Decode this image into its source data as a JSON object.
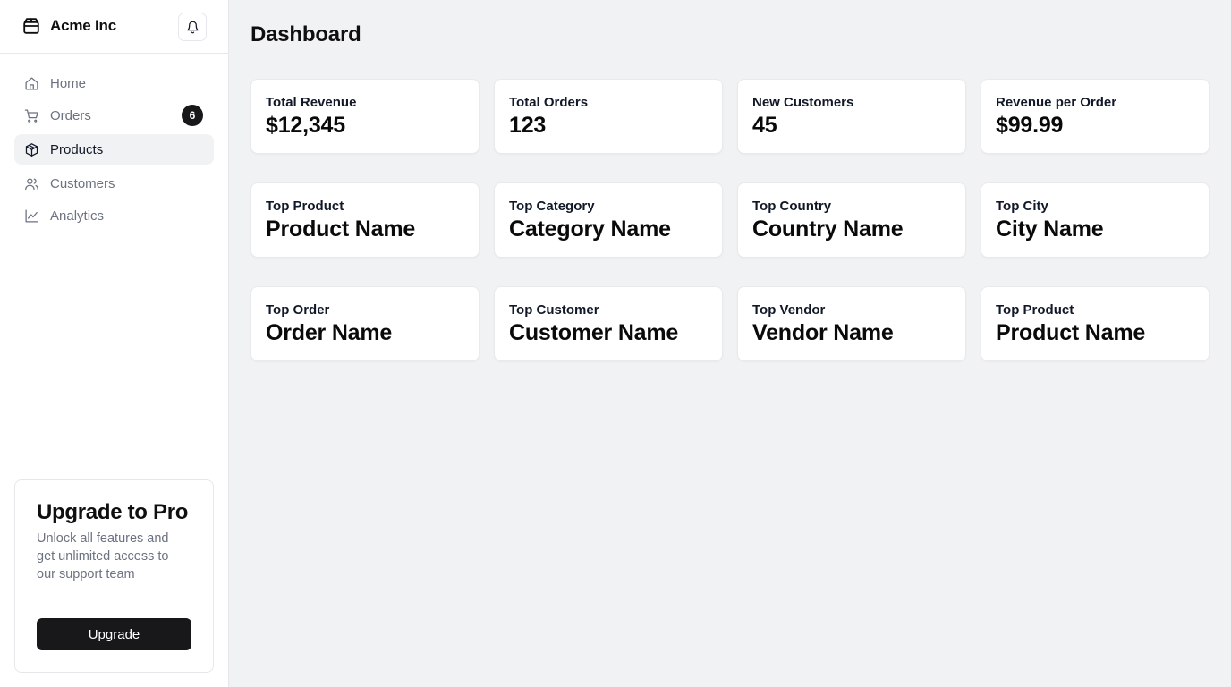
{
  "brand": {
    "name": "Acme Inc",
    "icon": "package-icon"
  },
  "header": {
    "notifications_icon": "bell-icon"
  },
  "sidebar": {
    "items": [
      {
        "label": "Home",
        "icon": "home-icon",
        "active": false
      },
      {
        "label": "Orders",
        "icon": "cart-icon",
        "active": false,
        "badge": "6"
      },
      {
        "label": "Products",
        "icon": "box-icon",
        "active": true
      },
      {
        "label": "Customers",
        "icon": "users-icon",
        "active": false
      },
      {
        "label": "Analytics",
        "icon": "line-chart-icon",
        "active": false
      }
    ]
  },
  "upgrade": {
    "title": "Upgrade to Pro",
    "description": "Unlock all features and get unlimited access to our support team",
    "button_label": "Upgrade"
  },
  "main": {
    "title": "Dashboard",
    "cards": [
      {
        "label": "Total Revenue",
        "value": "$12,345"
      },
      {
        "label": "Total Orders",
        "value": "123"
      },
      {
        "label": "New Customers",
        "value": "45"
      },
      {
        "label": "Revenue per Order",
        "value": "$99.99"
      },
      {
        "label": "Top Product",
        "value": "Product Name"
      },
      {
        "label": "Top Category",
        "value": "Category Name"
      },
      {
        "label": "Top Country",
        "value": "Country Name"
      },
      {
        "label": "Top City",
        "value": "City Name"
      },
      {
        "label": "Top Order",
        "value": "Order Name"
      },
      {
        "label": "Top Customer",
        "value": "Customer Name"
      },
      {
        "label": "Top Vendor",
        "value": "Vendor Name"
      },
      {
        "label": "Top Product",
        "value": "Product Name"
      }
    ]
  },
  "colors": {
    "page_bg": "#f1f2f4",
    "sidebar_bg": "#ffffff",
    "primary_button": "#18181b",
    "muted_text": "#6b7280",
    "active_item_bg": "#f1f2f4"
  }
}
